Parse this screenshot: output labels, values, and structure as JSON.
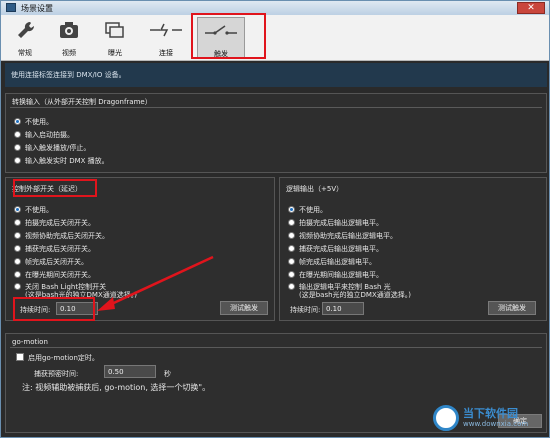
{
  "window": {
    "title": "场景设置",
    "close_glyph": "✕"
  },
  "toolbar": {
    "items": [
      {
        "label": "常规",
        "icon": "wrench-icon"
      },
      {
        "label": "视频",
        "icon": "camera-icon"
      },
      {
        "label": "曝光",
        "icon": "exposure-icon"
      },
      {
        "label": "连接",
        "icon": "connection-icon"
      },
      {
        "label": "触发",
        "icon": "switch-icon"
      }
    ]
  },
  "info": {
    "text": "使用连接标签连接到 DMX/IO 设备。"
  },
  "convert": {
    "heading": "转换输入（从外部开关控制 Dragonframe）",
    "options": [
      "不使用。",
      "输入启动拍摄。",
      "输入触发播放/停止。",
      "输入触发实时 DMX 播放。"
    ]
  },
  "external": {
    "heading": "控制外部开关（延迟）",
    "options": [
      "不使用。",
      "拍摄完成后关闭开关。",
      "视频协助完成后关闭开关。",
      "捕获完成后关闭开关。",
      "帧完成后关闭开关。",
      "在曝光期间关闭开关。",
      "关闭 Bash Light控制开关",
      "(这是bash光的独立DMX通道选择。)"
    ],
    "duration_label": "持续时间:",
    "duration_value": "0.10",
    "test_button": "测试触发"
  },
  "logic": {
    "heading": "逻辑输出（+5V）",
    "options": [
      "不使用。",
      "拍摄完成后输出逻辑电平。",
      "视频协助完成后输出逻辑电平。",
      "捕获完成后输出逻辑电平。",
      "帧完成后输出逻辑电平。",
      "在曝光期间输出逻辑电平。",
      "输出逻辑电平来控制 Bash 光",
      "(这是bash光的独立DMX通道选择。)"
    ],
    "duration_label": "持续时间:",
    "duration_value": "0.10",
    "test_button": "测试触发"
  },
  "gomotion": {
    "heading": "go-motion",
    "enable_label": "启用go-motion定时。",
    "capture_label": "捕获预密时间:",
    "capture_value": "0.50",
    "capture_unit": "秒",
    "note": "注: 视频辅助被捕获后, go-motion, 选择一个切换\"。",
    "confirm_button": "确定"
  },
  "watermark": {
    "title": "当下软件园",
    "subtitle": "www.downxia.com"
  },
  "colors": {
    "highlight": "#e0141c",
    "info_bg": "#22394d"
  }
}
